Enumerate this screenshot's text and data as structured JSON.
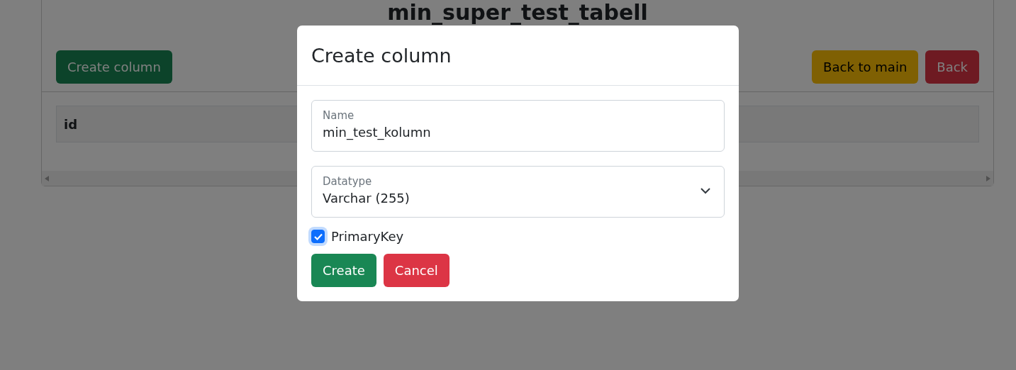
{
  "page": {
    "title": "min_super_test_tabell",
    "left_buttons": [
      {
        "label": "Create column",
        "kind": "success"
      }
    ],
    "right_buttons": [
      {
        "label": "Back to main",
        "kind": "warning"
      },
      {
        "label": "Back",
        "kind": "danger"
      }
    ]
  },
  "table": {
    "columns": [
      "id"
    ]
  },
  "modal": {
    "title": "Create column",
    "fields": [
      {
        "kind": "text",
        "label": "Name",
        "value": "min_test_kolumn"
      },
      {
        "kind": "select",
        "label": "Datatype",
        "value": "Varchar (255)"
      }
    ],
    "checkbox": {
      "label": "PrimaryKey",
      "checked": true
    },
    "buttons": [
      {
        "label": "Create",
        "kind": "success"
      },
      {
        "label": "Cancel",
        "kind": "danger"
      }
    ]
  }
}
